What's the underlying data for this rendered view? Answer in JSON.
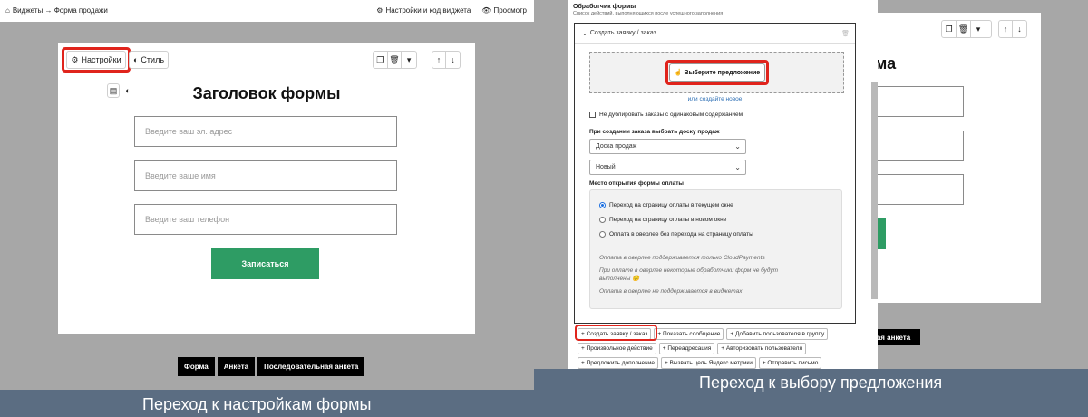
{
  "left": {
    "breadcrumb": "Виджеты → Форма продажи",
    "settings_code": "Настройки и код виджета",
    "preview": "Просмотр",
    "settings_btn": "Настройки",
    "style_btn": "Стиль",
    "form_title": "Заголовок формы",
    "email_placeholder": "Введите ваш эл. адрес",
    "name_placeholder": "Введите ваше имя",
    "phone_placeholder": "Введите ваш телефон",
    "submit": "Записаться",
    "tabs": [
      "Форма",
      "Анкета",
      "Последовательная анкета"
    ],
    "caption": "Переход к настройкам формы"
  },
  "right": {
    "header": "Обработчик формы",
    "subheader": "Список действий, выполняющихся после успешного заполнения",
    "handler_title": "Создать заявку / заказ",
    "choose_offer": "Выберите предложение",
    "or_create": "или создайте новое",
    "no_duplicate": "Не дублировать заказы с одинаковым содержанием",
    "board_label": "При создании заказа выбрать доску продаж",
    "board_value": "Доска продаж",
    "status_value": "Новый",
    "pay_label": "Место открытия формы оплаты",
    "pay_options": [
      "Переход на страницу оплаты в текущем окне",
      "Переход на страницу оплаты в новом окне",
      "Оплата в оверлее без перехода на страницу оплаты"
    ],
    "notes": [
      "Оплата в оверлее поддерживается только CloudPayments",
      "При оплате в оверлее некоторые обработчики форм не будут выполнены 😔",
      "Оплата в оверлее не поддерживается в виджетах"
    ],
    "actions": [
      "+ Создать заявку / заказ",
      "+ Показать сообщение",
      "+ Добавить пользователя в группу",
      "+ Произвольное действие",
      "+ Переадресация",
      "+ Авторизовать пользователя",
      "+ Предложить дополнение",
      "+ Вызвать цель Яндекс метрики",
      "+ Отправить письмо"
    ],
    "behind_title": "ма",
    "behind_tab": "ная анкета",
    "caption": "Переход к выбору предложения"
  },
  "colors": {
    "accent_red": "#e0241c",
    "submit_green": "#2e9c64",
    "link_blue": "#2a6db4",
    "frame_blue": "#5b6d82"
  }
}
